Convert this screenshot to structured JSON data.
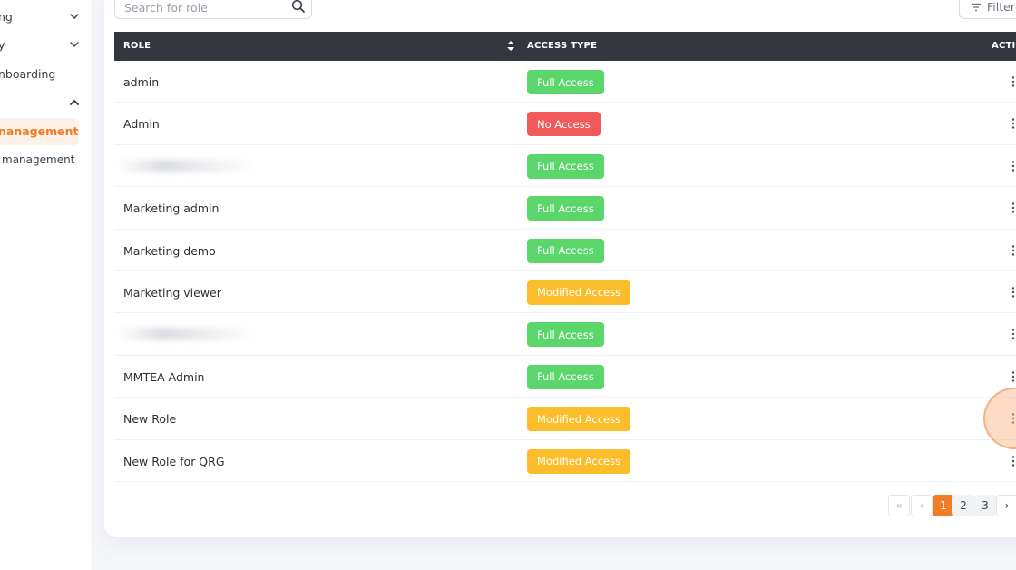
{
  "sidebar": {
    "items": [
      {
        "label": "ng"
      },
      {
        "label": "y"
      },
      {
        "label": "nboarding"
      }
    ],
    "active_label": "nanagement",
    "sub_label": "management"
  },
  "search": {
    "placeholder": "Search for role",
    "value": ""
  },
  "filter": {
    "label": "Filter"
  },
  "table": {
    "headers": {
      "role": "ROLE",
      "access": "ACCESS TYPE",
      "action": "ACTIO"
    },
    "rows": [
      {
        "role": "admin",
        "access": "Full Access",
        "type": "full"
      },
      {
        "role": "Admin",
        "access": "No Access",
        "type": "none"
      },
      {
        "role": "",
        "access": "Full Access",
        "type": "full",
        "redacted": true
      },
      {
        "role": "Marketing admin",
        "access": "Full Access",
        "type": "full"
      },
      {
        "role": "Marketing demo",
        "access": "Full Access",
        "type": "full"
      },
      {
        "role": "Marketing viewer",
        "access": "Modified Access",
        "type": "mod"
      },
      {
        "role": "",
        "access": "Full Access",
        "type": "full",
        "redacted": true
      },
      {
        "role": "MMTEA Admin",
        "access": "Full Access",
        "type": "full"
      },
      {
        "role": "New Role",
        "access": "Modified Access",
        "type": "mod"
      },
      {
        "role": "New Role for QRG",
        "access": "Modified Access",
        "type": "mod"
      }
    ]
  },
  "pagination": {
    "first": "«",
    "prev": "‹",
    "pages": [
      "1",
      "2",
      "3"
    ],
    "current": "1",
    "next": "›"
  },
  "colors": {
    "accent": "#f07c26",
    "full_access": "#5ad66b",
    "no_access": "#f25a5a",
    "modified_access": "#fbbd2a",
    "header_bg": "#33373d"
  }
}
